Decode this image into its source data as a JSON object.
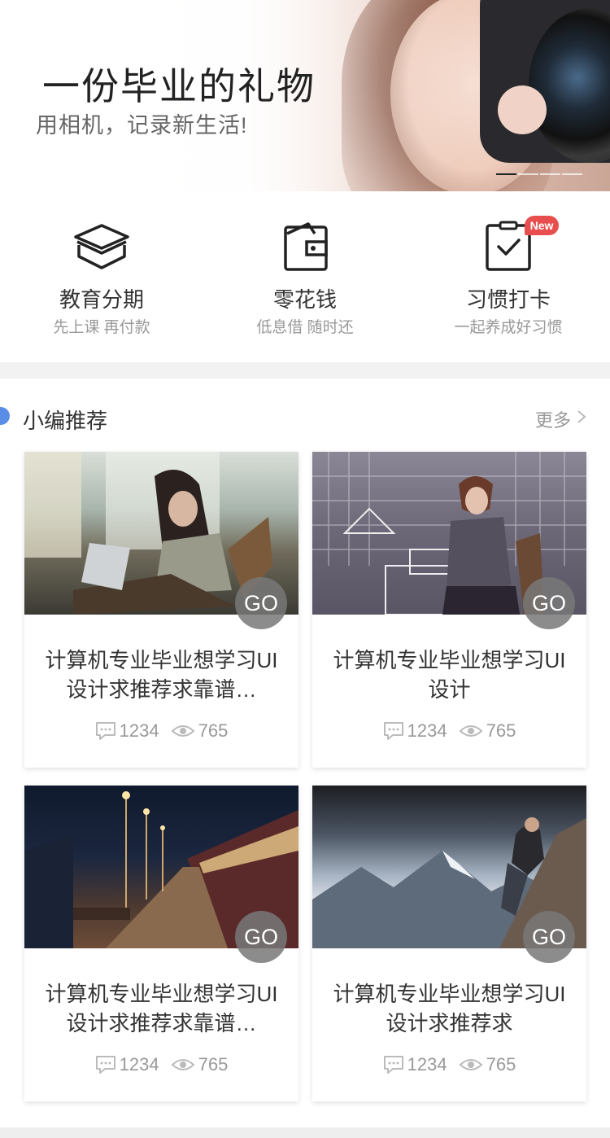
{
  "banner": {
    "title": "一份毕业的礼物",
    "subtitle": "用相机，记录新生活!",
    "slides": 4,
    "active_slide": 1
  },
  "services": [
    {
      "name": "教育分期",
      "sub": "先上课 再付款",
      "icon": "graduation-cap-icon"
    },
    {
      "name": "零花钱",
      "sub": "低息借 随时还",
      "icon": "wallet-icon"
    },
    {
      "name": "习惯打卡",
      "sub": "一起养成好习惯",
      "icon": "clipboard-check-icon",
      "badge": "New"
    }
  ],
  "section": {
    "title": "小编推荐",
    "more": "更多",
    "accent": "#5a8ee6"
  },
  "cards": [
    {
      "title": "计算机专业毕业想学习UI设计求推荐求靠谱…",
      "comments": "1234",
      "views": "765",
      "go": "GO"
    },
    {
      "title": "计算机专业毕业想学习UI设计",
      "comments": "1234",
      "views": "765",
      "go": "GO"
    },
    {
      "title": "计算机专业毕业想学习UI设计求推荐求靠谱…",
      "comments": "1234",
      "views": "765",
      "go": "GO"
    },
    {
      "title": "计算机专业毕业想学习UI设计求推荐求",
      "comments": "1234",
      "views": "765",
      "go": "GO"
    }
  ],
  "colors": {
    "badge": "#e84e4e",
    "accent": "#5a8ee6"
  }
}
